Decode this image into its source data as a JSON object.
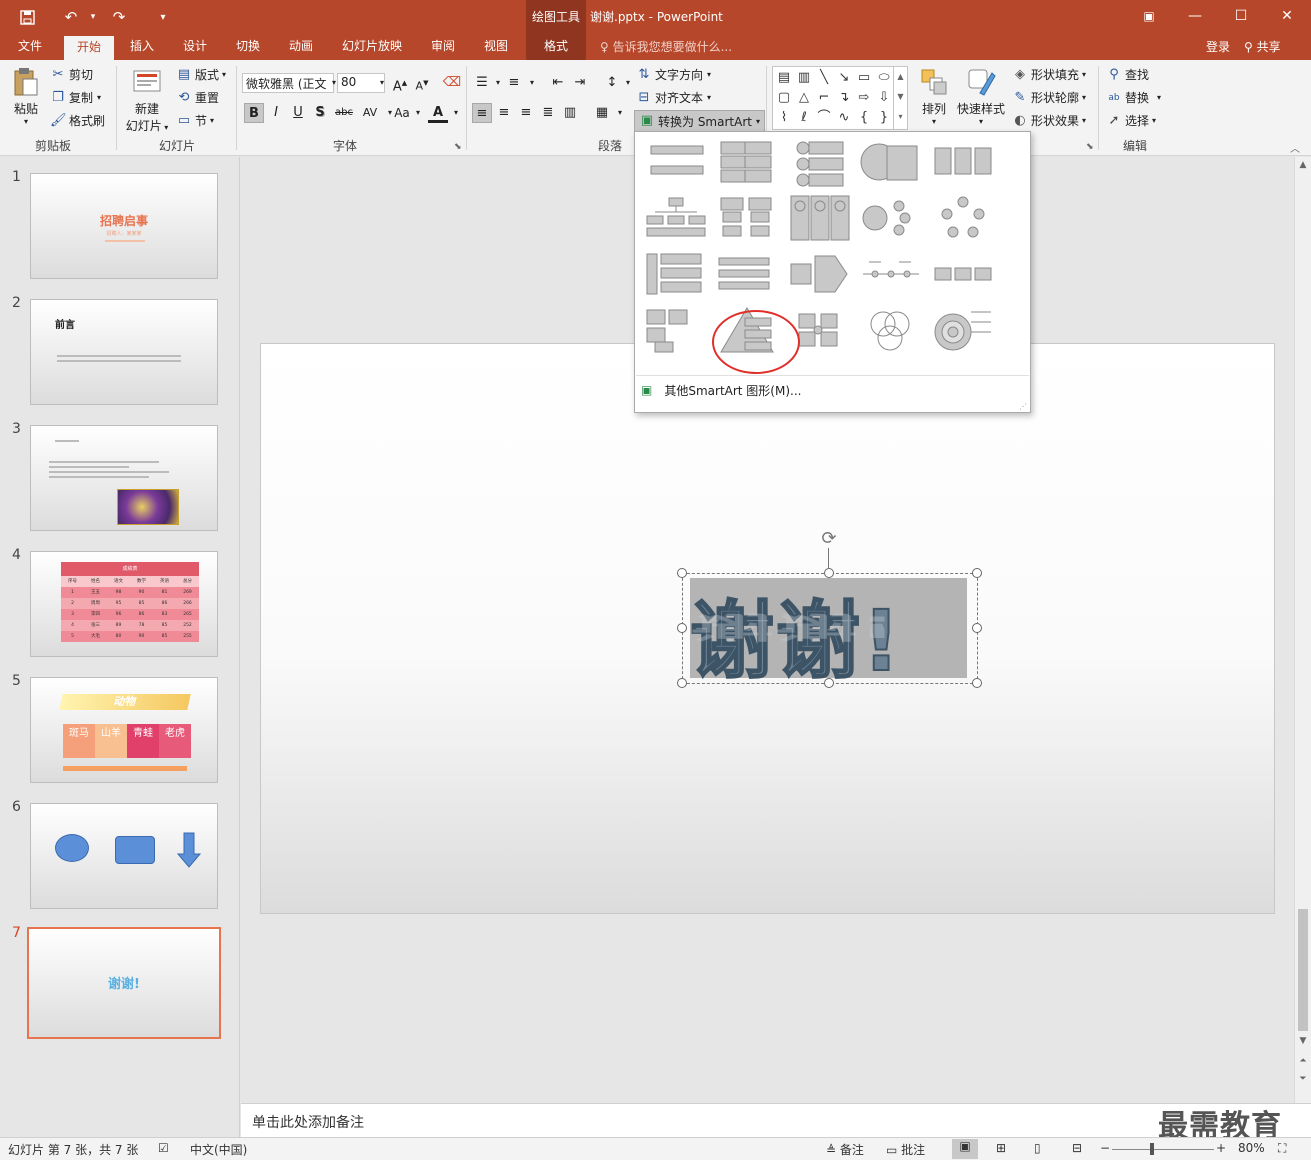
{
  "titlebar": {
    "context_tab": "绘图工具",
    "doc_title": "谢谢.pptx - PowerPoint",
    "qa_icons": [
      "save-icon",
      "undo-icon",
      "redo-icon",
      "customize-icon"
    ]
  },
  "tabs": [
    {
      "label": "文件",
      "active": false
    },
    {
      "label": "开始",
      "active": true
    },
    {
      "label": "插入",
      "active": false
    },
    {
      "label": "设计",
      "active": false
    },
    {
      "label": "切换",
      "active": false
    },
    {
      "label": "动画",
      "active": false
    },
    {
      "label": "幻灯片放映",
      "active": false
    },
    {
      "label": "审阅",
      "active": false
    },
    {
      "label": "视图",
      "active": false
    },
    {
      "label": "格式",
      "active": false
    }
  ],
  "tell_me": "告诉我您想要做什么...",
  "login": "登录",
  "share": "共享",
  "ribbon": {
    "clipboard": {
      "label": "剪贴板",
      "paste": "粘贴",
      "cut": "剪切",
      "copy": "复制",
      "format_painter": "格式刷"
    },
    "slides": {
      "label": "幻灯片",
      "new_slide_line1": "新建",
      "new_slide_line2": "幻灯片",
      "layout": "版式",
      "reset": "重置",
      "section": "节"
    },
    "font": {
      "label": "字体",
      "font_name": "微软雅黑 (正文",
      "font_size": "80",
      "bold": "B",
      "italic": "I",
      "underline": "U",
      "shadow": "S",
      "strike": "abc",
      "spacing": "AV",
      "case": "Aa",
      "color": "A"
    },
    "paragraph": {
      "label": "段落",
      "text_direction": "文字方向",
      "align_text": "对齐文本",
      "convert_smartart": "转换为 SmartArt"
    },
    "drawing": {
      "arrange": "排列",
      "quick_styles": "快速样式",
      "shape_fill": "形状填充",
      "shape_outline": "形状轮廓",
      "shape_effects": "形状效果"
    },
    "editing": {
      "label": "编辑",
      "find": "查找",
      "replace": "替换",
      "select": "选择"
    }
  },
  "smartart_dropdown": {
    "more_label": "其他SmartArt 图形(M)..."
  },
  "slides": [
    {
      "num": "1",
      "title": "招聘启事",
      "sub": "招聘人：某某某"
    },
    {
      "num": "2",
      "title": "前言"
    },
    {
      "num": "3"
    },
    {
      "num": "4",
      "table_title": "成绩表",
      "headers": [
        "序号",
        "姓名",
        "语文",
        "数学",
        "英语",
        "总分"
      ],
      "rows": [
        [
          "1",
          "王五",
          "98",
          "90",
          "81",
          "269"
        ],
        [
          "2",
          "周周",
          "95",
          "85",
          "86",
          "266"
        ],
        [
          "3",
          "李四",
          "96",
          "86",
          "83",
          "265"
        ],
        [
          "4",
          "张三",
          "89",
          "78",
          "85",
          "252"
        ],
        [
          "5",
          "大毛",
          "80",
          "90",
          "85",
          "255"
        ]
      ]
    },
    {
      "num": "5",
      "title": "动物",
      "tiles": [
        "斑马",
        "山羊",
        "青蛙",
        "老虎"
      ]
    },
    {
      "num": "6"
    },
    {
      "num": "7",
      "title": "谢谢!"
    }
  ],
  "main_slide_text": "谢谢!",
  "notes_placeholder": "单击此处添加备注",
  "watermark": "最需教育",
  "status": {
    "slide_info": "幻灯片 第 7 张，共 7 张",
    "language": "中文(中国)",
    "notes": "备注",
    "comments": "批注",
    "zoom": "80%"
  }
}
